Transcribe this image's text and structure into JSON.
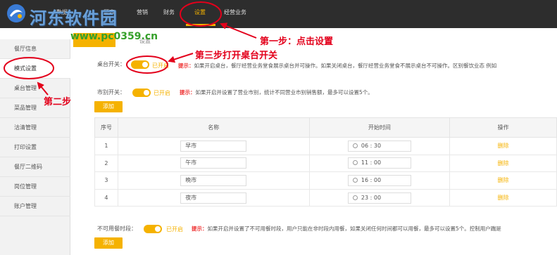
{
  "brand": {
    "watermark": "河东软件园",
    "watermark_url": "www.pc0359.cn",
    "accent": "#f5b200",
    "annotation_red": "#e3001b"
  },
  "nav": {
    "items": [
      {
        "label": "数据"
      },
      {
        "label": "顾客"
      },
      {
        "label": "营销"
      },
      {
        "label": "财务"
      },
      {
        "label": "设置"
      },
      {
        "label": "经营业务"
      }
    ],
    "active": "设置"
  },
  "subhead": {
    "crumb": "设置"
  },
  "sidebar": {
    "items": [
      {
        "label": "餐厅信息"
      },
      {
        "label": "模式设置"
      },
      {
        "label": "桌台管理"
      },
      {
        "label": "菜品管理"
      },
      {
        "label": "沽清管理"
      },
      {
        "label": "打印设置"
      },
      {
        "label": "餐厅二维码"
      },
      {
        "label": "岗位管理"
      },
      {
        "label": "账户管理"
      }
    ],
    "active": "模式设置"
  },
  "settings": {
    "table_switch": {
      "label": "桌台开关：",
      "state": "已开启",
      "tip_label": "提示：",
      "tip": "如果开启桌台，餐厅经营业务堂食展示桌台并可操作。如果关闭桌台，餐厅经营业务堂食不展示桌台不可操作。区别餐饮业态 例如"
    },
    "market_switch": {
      "label": "市别开关：",
      "state": "已开启",
      "tip_label": "提示：",
      "tip": "如果开启并设置了营业市别，统计不同营业市别销售额，最多可以设置5个。"
    },
    "add_label": "添加",
    "no_dining_switch": {
      "label": "不可用餐时段：",
      "state": "已开启",
      "tip_label": "提示：",
      "tip": "如果开启并设置了不可用餐时段，用户只能在非时段内用餐，如果关闭任何时间都可以用餐，最多可以设置5个。控制用户踹是"
    },
    "add_label_2": "添加"
  },
  "periods_table": {
    "columns": [
      "序号",
      "名称",
      "开始时间",
      "操作"
    ],
    "rows": [
      {
        "no": "1",
        "name": "早市",
        "time": "06 : 30",
        "action": "删除"
      },
      {
        "no": "2",
        "name": "午市",
        "time": "11 : 00",
        "action": "删除"
      },
      {
        "no": "3",
        "name": "晚市",
        "time": "16 : 00",
        "action": "删除"
      },
      {
        "no": "4",
        "name": "夜市",
        "time": "23 : 00",
        "action": "删除"
      }
    ]
  },
  "annotations": {
    "step1": "第一步：点击设置",
    "step2": "第二步",
    "step3": "第三步打开桌台开关"
  }
}
